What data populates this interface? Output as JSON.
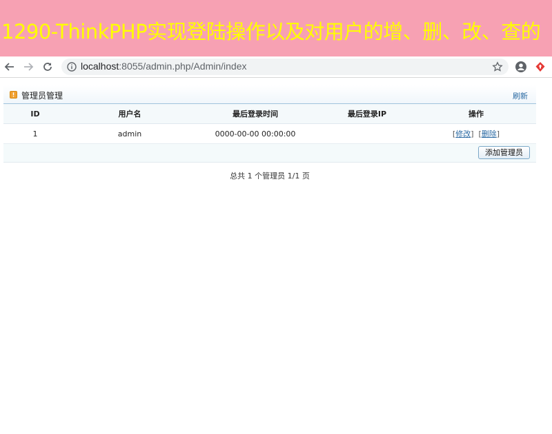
{
  "banner": {
    "title": "1290-ThinkPHP实现登陆操作以及对用户的增、删、改、查的"
  },
  "browser": {
    "url_host": "localhost",
    "url_rest": ":8055/admin.php/Admin/index"
  },
  "panel": {
    "title": "管理员管理",
    "refresh": "刷新",
    "columns": [
      "ID",
      "用户名",
      "最后登录时间",
      "最后登录IP",
      "操作"
    ],
    "rows": [
      {
        "id": "1",
        "username": "admin",
        "last_login_time": "0000-00-00 00:00:00",
        "last_login_ip": "",
        "edit": "修改",
        "delete": "删除"
      }
    ],
    "add_button": "添加管理员",
    "pager": "总共 1 个管理员 1/1 页"
  },
  "colors": {
    "banner_bg": "#f7a1b3",
    "banner_text": "#ffff00",
    "link": "#2b6aa3"
  }
}
